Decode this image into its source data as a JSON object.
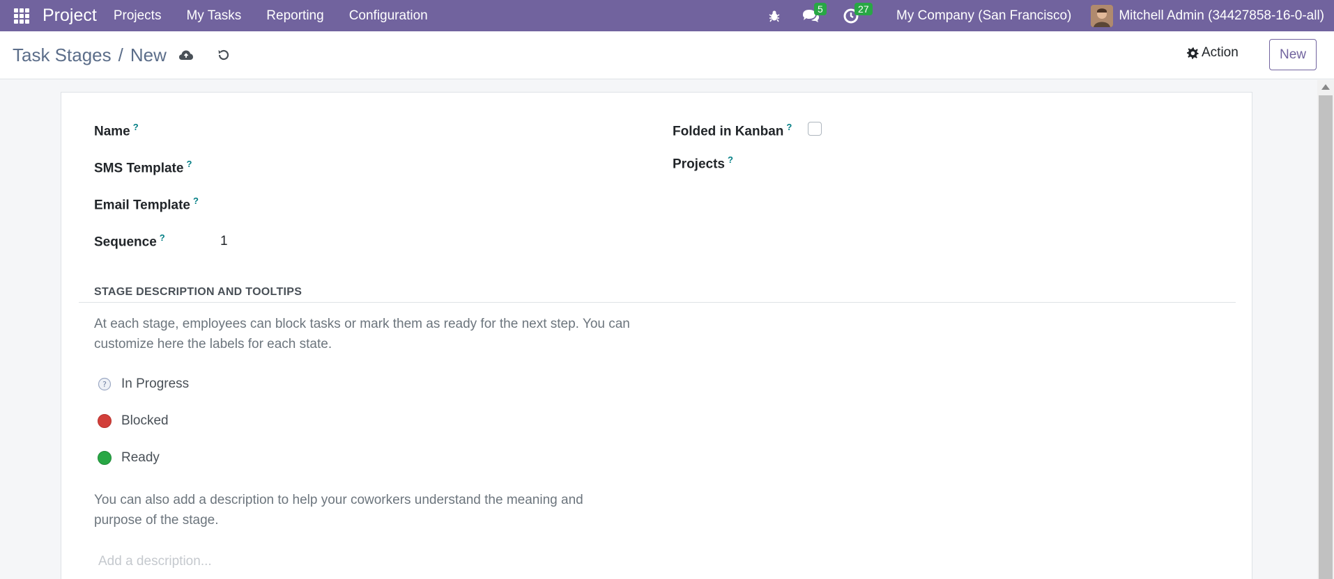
{
  "navbar": {
    "brand": "Project",
    "menu": [
      "Projects",
      "My Tasks",
      "Reporting",
      "Configuration"
    ],
    "messages_count": "5",
    "activities_count": "27",
    "company": "My Company (San Francisco)",
    "user": "Mitchell Admin (34427858-16-0-all)"
  },
  "control_panel": {
    "breadcrumb_parent": "Task Stages",
    "breadcrumb_separator": "/",
    "breadcrumb_current": "New",
    "action_label": "Action",
    "new_label": "New"
  },
  "form": {
    "fields": {
      "name_label": "Name",
      "sms_template_label": "SMS Template",
      "email_template_label": "Email Template",
      "sequence_label": "Sequence",
      "sequence_value": "1",
      "folded_label": "Folded in Kanban",
      "projects_label": "Projects",
      "help_mark": "?"
    },
    "section_title": "STAGE DESCRIPTION AND TOOLTIPS",
    "section_intro_line1": "At each stage, employees can block tasks or mark them as ready for the next step. You can",
    "section_intro_line2": "customize here the labels for each state.",
    "states": [
      {
        "label": "In Progress",
        "color": "#e9ecef"
      },
      {
        "label": "Blocked",
        "color": "#d23f3a"
      },
      {
        "label": "Ready",
        "color": "#28a745"
      }
    ],
    "description_hint_line1": "You can also add a description to help your coworkers understand the meaning and",
    "description_hint_line2": "purpose of the stage.",
    "description_placeholder": "Add a description..."
  }
}
